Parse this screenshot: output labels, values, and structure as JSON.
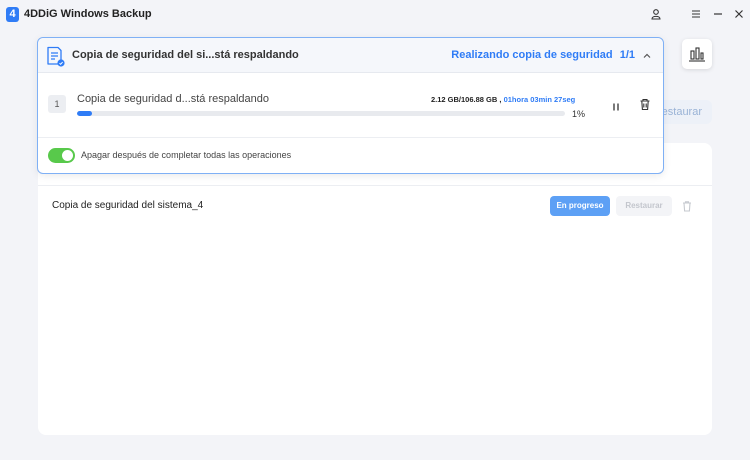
{
  "app": {
    "title": "4DDiG Windows Backup",
    "logo_letter": "4"
  },
  "window_controls": {
    "account": "account-icon",
    "settings": "settings-icon",
    "minimize": "minimize-icon",
    "close": "close-icon"
  },
  "panel": {
    "title": "Copia de seguridad del si...stá respaldando",
    "status": "Realizando copia de seguridad",
    "count": "1/1",
    "task": {
      "number": "1",
      "name": "Copia de seguridad d...stá respaldando",
      "size": "2.12 GB/106.88 GB ,",
      "time": "01hora 03min 27seg",
      "progress_percent": 1,
      "percent_label": "1%"
    },
    "toggle": {
      "on": true,
      "label": "Apagar después de completar todas las operaciones"
    }
  },
  "background": {
    "restore_label": "Restaurar",
    "row": {
      "name": "Copia de seguridad del sistema_4",
      "status_button": "En progreso",
      "restore_button": "Restaurar"
    }
  },
  "colors": {
    "accent": "#2f7cf6",
    "toggle": "#58c94b",
    "progress_button": "#5da0f5"
  }
}
